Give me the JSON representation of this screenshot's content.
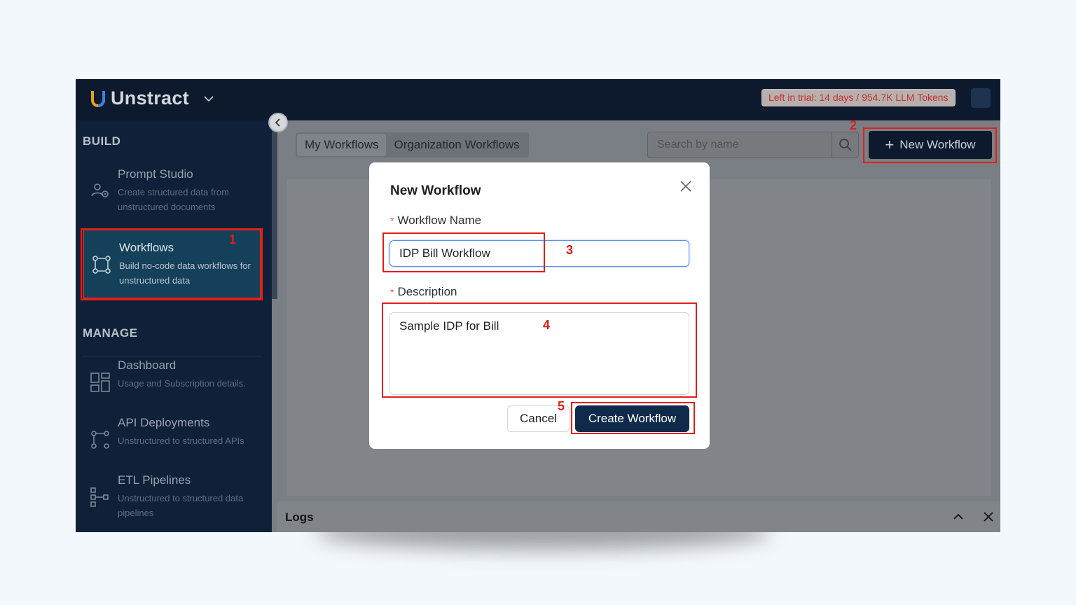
{
  "topbar": {
    "app_name": "Unstract",
    "trial_badge": "Left in trial: 14 days / 954.7K LLM Tokens"
  },
  "sidebar": {
    "build_title": "BUILD",
    "manage_title": "MANAGE",
    "items": [
      {
        "title": "Prompt Studio",
        "desc": "Create structured data from unstructured documents",
        "icon": "prompt-studio-icon"
      },
      {
        "title": "Workflows",
        "desc": "Build no-code data workflows for unstructured data",
        "icon": "workflows-icon"
      },
      {
        "title": "Dashboard",
        "desc": "Usage and Subscription details.",
        "icon": "dashboard-icon"
      },
      {
        "title": "API Deployments",
        "desc": "Unstructured to structured APIs",
        "icon": "api-deployments-icon"
      },
      {
        "title": "ETL Pipelines",
        "desc": "Unstructured to structured data pipelines",
        "icon": "etl-pipelines-icon"
      }
    ]
  },
  "main": {
    "tabs": [
      {
        "label": "My Workflows"
      },
      {
        "label": "Organization Workflows"
      }
    ],
    "search_placeholder": "Search by name",
    "new_workflow_label": "New Workflow",
    "logs_label": "Logs"
  },
  "modal": {
    "title": "New Workflow",
    "name_label": "Workflow Name",
    "name_value": "IDP Bill Workflow",
    "description_label": "Description",
    "description_value": "Sample IDP for Bill",
    "cancel_label": "Cancel",
    "create_label": "Create Workflow"
  },
  "annotations": [
    "1",
    "2",
    "3",
    "4",
    "5"
  ],
  "colors": {
    "navy": "#0d1a2e",
    "annotation_red": "#e41e17",
    "primary_button": "#0f2a4a"
  }
}
